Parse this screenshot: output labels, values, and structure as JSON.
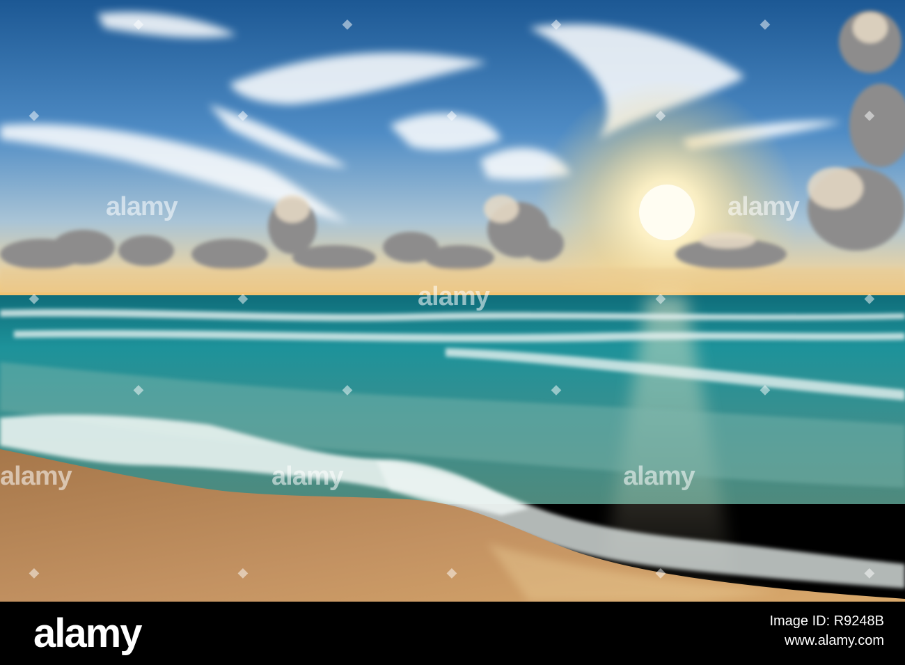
{
  "watermark": {
    "text": "alamy"
  },
  "footer": {
    "logo": "alamy",
    "image_id_label": "Image ID: R9248B",
    "site": "www.alamy.com"
  },
  "colors": {
    "sky_top": "#1f5f9e",
    "sky_mid": "#5c93c8",
    "horizon": "#f3c77a",
    "sea": "#1d8d95",
    "foam": "#eaf4f2",
    "sand": "#b98a55",
    "footer": "#000000"
  }
}
